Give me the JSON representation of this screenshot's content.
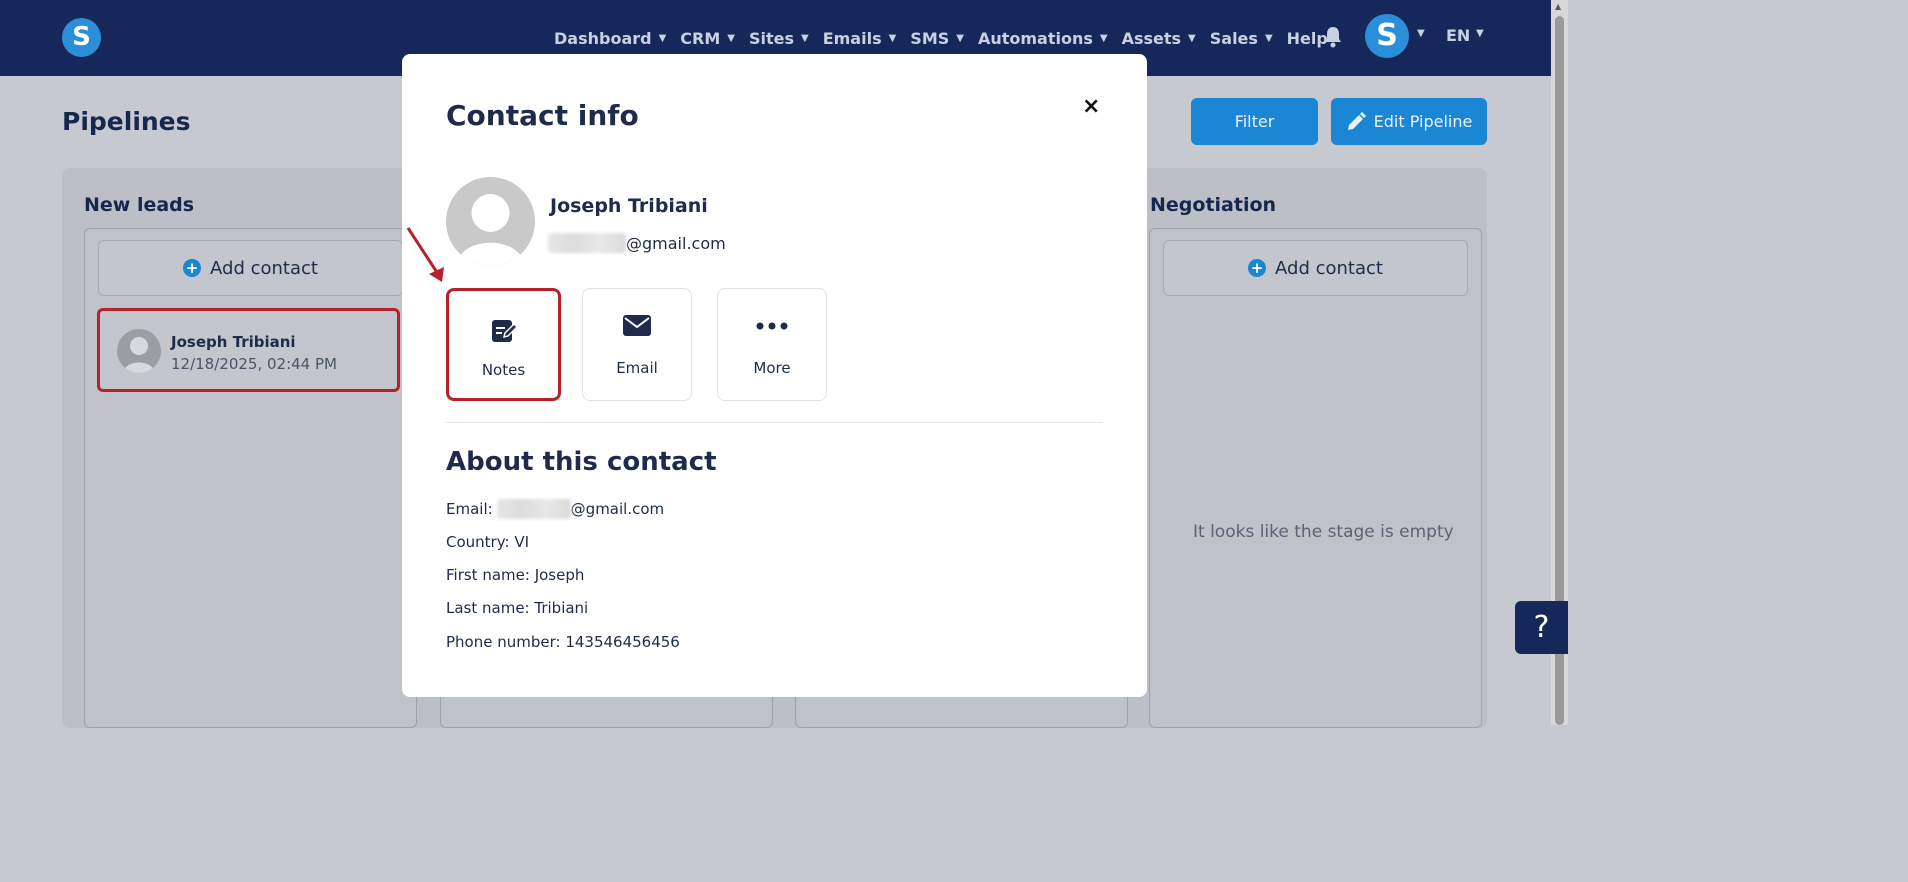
{
  "brand": {
    "logo_letter": "S",
    "accent": "#1a86d4",
    "nav_bg": "#16285a",
    "highlight": "#b5222b"
  },
  "nav": {
    "items": [
      {
        "label": "Dashboard",
        "dropdown": true
      },
      {
        "label": "CRM",
        "dropdown": true
      },
      {
        "label": "Sites",
        "dropdown": true
      },
      {
        "label": "Emails",
        "dropdown": true
      },
      {
        "label": "SMS",
        "dropdown": true
      },
      {
        "label": "Automations",
        "dropdown": true
      },
      {
        "label": "Assets",
        "dropdown": true
      },
      {
        "label": "Sales",
        "dropdown": true
      },
      {
        "label": "Help",
        "dropdown": false
      }
    ],
    "bell_icon": "bell-icon",
    "user_letter": "S",
    "language": "EN"
  },
  "page": {
    "title": "Pipelines",
    "filter_label": "Filter",
    "edit_label": "Edit Pipeline"
  },
  "board": {
    "col_new_leads": "New leads",
    "col_negotiation": "Negotiation",
    "add_contact": "Add contact",
    "lead": {
      "name": "Joseph Tribiani",
      "date": "12/18/2025, 02:44 PM"
    },
    "empty_text": "It looks like the stage is empty"
  },
  "help": {
    "label": "?"
  },
  "modal": {
    "title": "Contact info",
    "close": "×",
    "name": "Joseph Tribiani",
    "email_suffix": "@gmail.com",
    "actions": {
      "notes": "Notes",
      "email": "Email",
      "more": "More"
    },
    "about_title": "About this contact",
    "details": {
      "email_label": "Email:",
      "email_suffix": "@gmail.com",
      "country": "Country: VI",
      "first_name": "First name: Joseph",
      "last_name": "Last name: Tribiani",
      "phone": "Phone number: 143546456456"
    }
  }
}
